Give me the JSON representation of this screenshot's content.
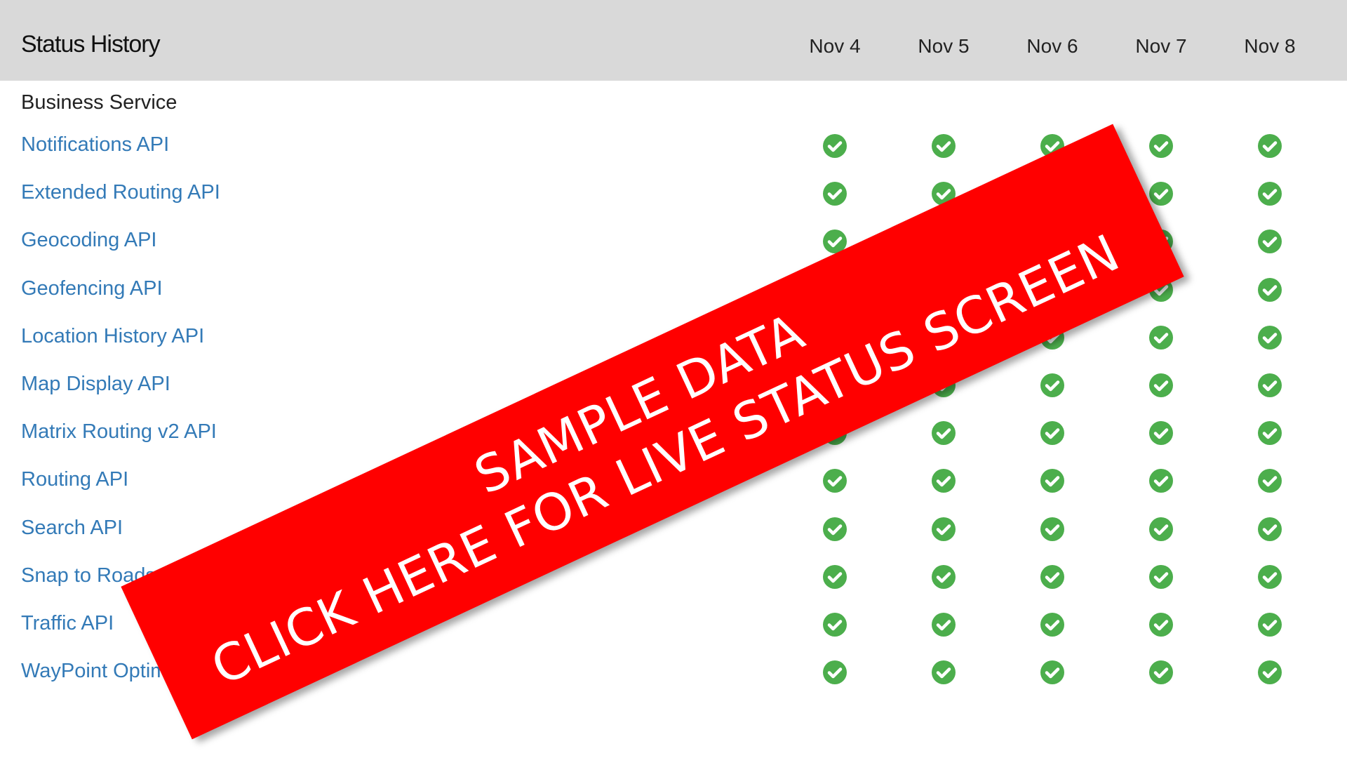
{
  "header": {
    "title": "Status History",
    "dates": [
      "Nov 4",
      "Nov 5",
      "Nov 6",
      "Nov 7",
      "Nov 8"
    ]
  },
  "group": {
    "label": "Business Service"
  },
  "services": [
    {
      "name": "Notifications API",
      "status": [
        "ok",
        "ok",
        "ok",
        "ok",
        "ok"
      ]
    },
    {
      "name": "Extended Routing API",
      "status": [
        "ok",
        "ok",
        "ok",
        "ok",
        "ok"
      ]
    },
    {
      "name": "Geocoding API",
      "status": [
        "ok",
        "ok",
        "ok",
        "ok",
        "ok"
      ]
    },
    {
      "name": "Geofencing API",
      "status": [
        "ok",
        "ok",
        "ok",
        "ok",
        "ok"
      ]
    },
    {
      "name": "Location History API",
      "status": [
        "ok",
        "ok",
        "ok",
        "ok",
        "ok"
      ]
    },
    {
      "name": "Map Display API",
      "status": [
        "ok",
        "ok",
        "ok",
        "ok",
        "ok"
      ]
    },
    {
      "name": "Matrix Routing v2 API",
      "status": [
        "ok",
        "ok",
        "ok",
        "ok",
        "ok"
      ]
    },
    {
      "name": "Routing API",
      "status": [
        "ok",
        "ok",
        "ok",
        "ok",
        "ok"
      ]
    },
    {
      "name": "Search API",
      "status": [
        "ok",
        "ok",
        "ok",
        "ok",
        "ok"
      ]
    },
    {
      "name": "Snap to Roads API",
      "status": [
        "ok",
        "ok",
        "ok",
        "ok",
        "ok"
      ]
    },
    {
      "name": "Traffic API",
      "status": [
        "ok",
        "ok",
        "ok",
        "ok",
        "ok"
      ]
    },
    {
      "name": "WayPoint Optimization API",
      "status": [
        "ok",
        "ok",
        "ok",
        "ok",
        "ok"
      ]
    }
  ],
  "status_icons": {
    "ok": "check-circle-icon"
  },
  "colors": {
    "ok": "#4cae4c",
    "link": "#337ab7",
    "banner": "#ff0000",
    "header_bg": "#d9d9d9"
  },
  "banner": {
    "line1": "SAMPLE DATA",
    "line2": "CLICK HERE FOR LIVE STATUS SCREEN"
  }
}
